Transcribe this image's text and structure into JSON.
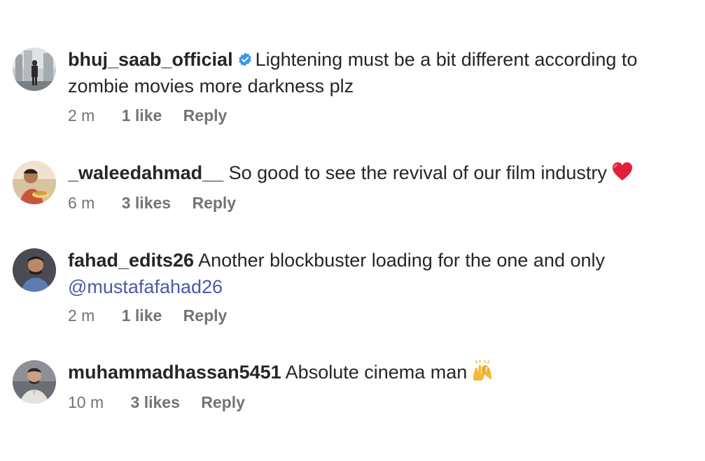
{
  "comments": [
    {
      "username": "bhuj_saab_official",
      "verified": true,
      "text_line1": "Lightening must be a bit different according to",
      "text_line2": "zombie movies more darkness plz",
      "time": "2 m",
      "likes": "1 like",
      "reply": "Reply",
      "avatar_icon": "avatar-photo-city"
    },
    {
      "username": "_waleedahmad__",
      "verified": false,
      "text_line1": "So good to see the revival of our film industry",
      "emoji": "red-heart-icon",
      "time": "6 m",
      "likes": "3 likes",
      "reply": "Reply",
      "avatar_icon": "avatar-photo-person"
    },
    {
      "username": "fahad_edits26",
      "verified": false,
      "text_line1": "Another blockbuster loading for the one and only",
      "mention": "@mustafafahad26",
      "time": "2 m",
      "likes": "1 like",
      "reply": "Reply",
      "avatar_icon": "avatar-photo-person"
    },
    {
      "username": "muhammadhassan5451",
      "verified": false,
      "text_line1": "Absolute cinema man",
      "emoji": "raising-hands-icon",
      "time": "10 m",
      "likes": "3 likes",
      "reply": "Reply",
      "avatar_icon": "avatar-photo-person"
    }
  ],
  "colors": {
    "text": "#262626",
    "meta": "#737373",
    "mention": "#4a5aa8",
    "verified": "#3897f0",
    "heart": "#e0203a"
  }
}
